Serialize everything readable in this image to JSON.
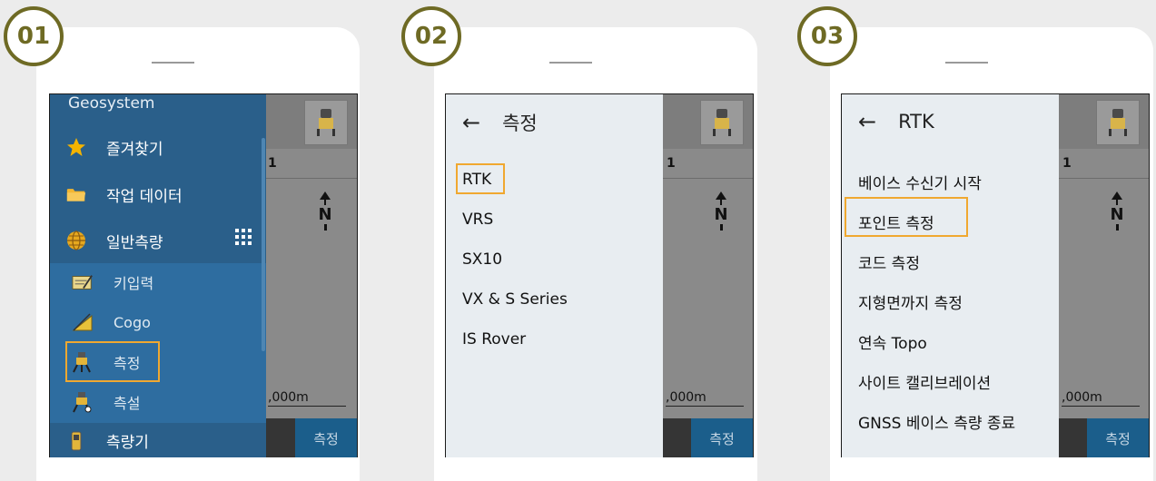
{
  "panels": [
    {
      "step": "01",
      "drawer": {
        "brand": "Geosystem",
        "items": [
          {
            "label": "즐겨찾기",
            "icon": "star-icon"
          },
          {
            "label": "작업 데이터",
            "icon": "folder-icon"
          },
          {
            "label": "일반측량",
            "icon": "globe-icon"
          }
        ],
        "sub_items": [
          {
            "label": "키입력",
            "icon": "keyboard-entry-icon"
          },
          {
            "label": "Cogo",
            "icon": "cogo-icon"
          },
          {
            "label": "측정",
            "icon": "survey-instrument-icon"
          },
          {
            "label": "측설",
            "icon": "stakeout-icon"
          }
        ],
        "bottom_item": {
          "label": "측량기",
          "icon": "instrument-icon"
        }
      },
      "map": {
        "number": "1",
        "north": "N",
        "scale": ",000m",
        "measure": "측정"
      }
    },
    {
      "step": "02",
      "menu": {
        "back": "←",
        "title": "측정",
        "items": [
          "RTK",
          "VRS",
          "SX10",
          "VX & S Series",
          "IS Rover"
        ]
      },
      "map": {
        "number": "1",
        "north": "N",
        "scale": ",000m",
        "measure": "측정"
      }
    },
    {
      "step": "03",
      "menu": {
        "back": "←",
        "title": "RTK",
        "items": [
          "베이스 수신기 시작",
          "포인트 측정",
          "코드 측정",
          "지형면까지 측정",
          "연속 Topo",
          "사이트 캘리브레이션",
          "GNSS 베이스 측량 종료"
        ]
      },
      "map": {
        "number": "1",
        "north": "N",
        "scale": ",000m",
        "measure": "측정"
      }
    }
  ],
  "colors": {
    "step_ring": "#6e6a24",
    "highlight": "#f0a830",
    "drawer": "#2a5f8a",
    "menu_bg": "#e8edf1",
    "measure_button": "#1b5e8b"
  }
}
